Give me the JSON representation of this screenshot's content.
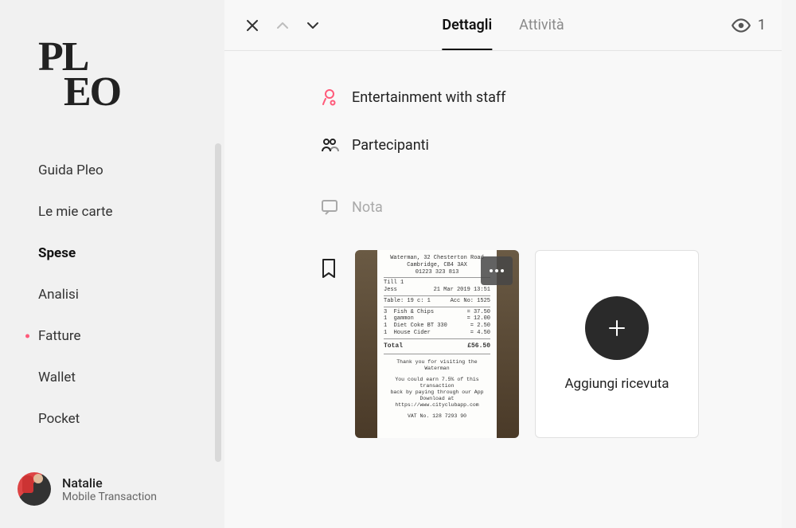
{
  "brand": {
    "line1": "PL",
    "line2": "EO"
  },
  "sidebar": {
    "items": [
      {
        "label": "Guida Pleo",
        "active": false,
        "dot": false
      },
      {
        "label": "Le mie carte",
        "active": false,
        "dot": false
      },
      {
        "label": "Spese",
        "active": true,
        "dot": false
      },
      {
        "label": "Analisi",
        "active": false,
        "dot": false
      },
      {
        "label": "Fatture",
        "active": false,
        "dot": true
      },
      {
        "label": "Wallet",
        "active": false,
        "dot": false
      },
      {
        "label": "Pocket",
        "active": false,
        "dot": false
      }
    ]
  },
  "user": {
    "name": "Natalie",
    "subtitle": "Mobile Transaction"
  },
  "tabs": {
    "details": "Dettagli",
    "activity": "Attività"
  },
  "watchers": {
    "count": "1"
  },
  "detail": {
    "category": "Entertainment with staff",
    "participants_label": "Partecipanti",
    "note_placeholder": "Nota"
  },
  "add_receipt_label": "Aggiungi ricevuta",
  "receipt": {
    "merchant": "Waterman, 32 Chesterton Road",
    "address": "Cambridge, CB4 3AX",
    "phone": "01223 323 813",
    "till": "Till 1",
    "server": "Jess",
    "datetime": "21 Mar 2019 13:51",
    "table": "Table: 19  c: 1",
    "account": "Acc No: 1525",
    "items": [
      {
        "qty": "3",
        "name": "Fish & Chips",
        "price": "37.50"
      },
      {
        "qty": "1",
        "name": "gammon",
        "price": "12.00"
      },
      {
        "qty": "1",
        "name": "Diet Coke BT 330",
        "price": "2.50"
      },
      {
        "qty": "1",
        "name": "House Cider",
        "price": "4.50"
      }
    ],
    "total_label": "Total",
    "total": "£56.50",
    "thanks": "Thank you for visiting the Waterman",
    "promo1": "You could earn 7.5% of this transaction",
    "promo2": "back by paying through our App",
    "promo3": "Download at https://www.cityclubapp.com",
    "vat": "VAT No. 128 7293 90"
  }
}
